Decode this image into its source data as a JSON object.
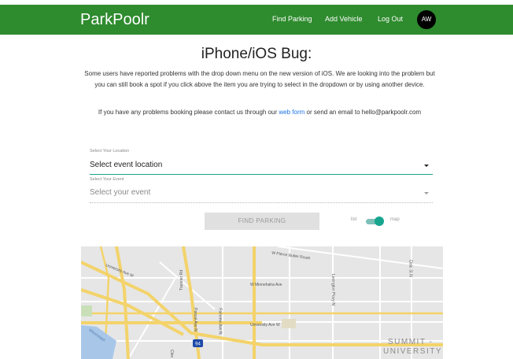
{
  "navbar": {
    "brand": "ParkPoolr",
    "links": [
      "Find Parking",
      "Add Vehicle",
      "Log Out"
    ],
    "avatar_initials": "AW",
    "color": "#2e8b2e"
  },
  "main": {
    "title": "iPhone/iOS Bug:",
    "notice": "Some users have reported problems with the drop down menu on the new version of iOS. We are looking into the problem but you can still book a spot if you click above the item you are trying to select in the dropdown or by using another device.",
    "contact_prefix": "If you have any problems booking please contact us through our",
    "contact_link": "web form",
    "contact_suffix": "or send an email to hello@parkpoolr.com"
  },
  "form": {
    "location_label": "Select Your Location",
    "location_value": "Select event location",
    "event_label": "Select Your Event",
    "event_value": "Select your event",
    "find_button": "FIND PARKING",
    "toggle_left": "list",
    "toggle_right": "map",
    "toggle_on": true
  },
  "map": {
    "labels": {
      "pierce_butler": "W Pierce Butler Route",
      "university_nw": "University Ave W",
      "transfer": "Transfer Rd",
      "minnehaha": "W Minnehaha Ave",
      "lexington": "Lexington Pkwy N",
      "dale": "Dale St N",
      "pascal": "Pascal Ave N",
      "fairview": "Fairview Ave N",
      "university_w": "University Ave W",
      "cleveland": "Clev",
      "river": "Mississippi",
      "shield": "94"
    },
    "summit_line1": "SUMMIT -",
    "summit_line2": "UNIVERSITY"
  }
}
